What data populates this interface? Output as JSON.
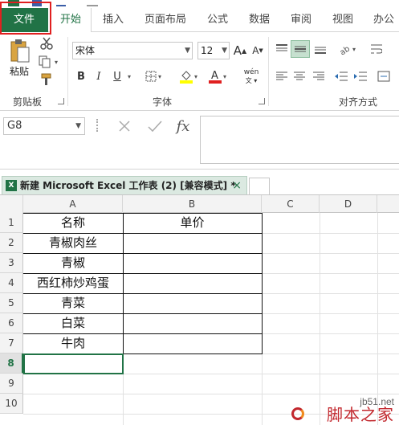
{
  "ribbon_tabs": [
    "文件",
    "开始",
    "插入",
    "页面布局",
    "公式",
    "数据",
    "审阅",
    "视图",
    "办公"
  ],
  "clipboard": {
    "paste_label": "粘贴",
    "group_label": "剪贴板"
  },
  "font": {
    "name": "宋体",
    "size": "12",
    "group_label": "字体",
    "bold": "B",
    "italic": "I",
    "underline": "U",
    "phonetic": "wén",
    "increase": "A",
    "decrease": "A"
  },
  "alignment": {
    "group_label": "对齐方式"
  },
  "formula_bar": {
    "name_box": "G8",
    "fx": "fx",
    "value": ""
  },
  "workbook_tab": {
    "title": "新建 Microsoft Excel 工作表 (2)  [兼容模式] *",
    "close": "×"
  },
  "columns": [
    "A",
    "B",
    "C",
    "D"
  ],
  "rows": [
    "1",
    "2",
    "3",
    "4",
    "5",
    "6",
    "7",
    "8",
    "9",
    "10"
  ],
  "table": {
    "headers": [
      "名称",
      "单价"
    ],
    "items": [
      "青椒肉丝",
      "青椒",
      "西红柿炒鸡蛋",
      "青菜",
      "白菜",
      "牛肉"
    ]
  },
  "watermark": {
    "url": "jb51.net",
    "text": "脚本之家"
  },
  "colors": {
    "accent": "#217346",
    "highlight_box": "#e02020",
    "font_color_bar": "#e02020",
    "fill_color_bar": "#ffff00"
  }
}
